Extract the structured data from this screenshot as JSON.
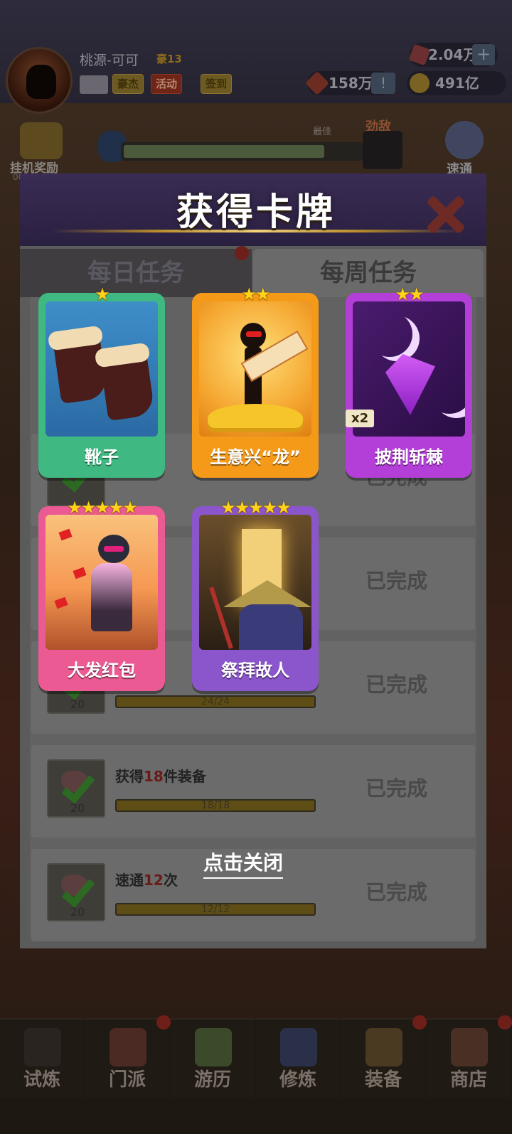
{
  "player": {
    "name": "桃源-可可",
    "rank": "豪13",
    "tags": [
      "豪杰",
      "活动",
      "签到"
    ]
  },
  "resources": {
    "gems": "2.04万",
    "ruby": "158万",
    "gold": "491亿"
  },
  "hud": {
    "hang_reward_label": "挂机奖励",
    "hang_timer": "00:04:43",
    "best_label": "最佳",
    "enemy_label": "劲敌",
    "pass_label": "速通"
  },
  "popup": {
    "title": "获得卡牌",
    "close_hint": "点击关闭"
  },
  "tabs": {
    "daily": "每日任务",
    "weekly": "每周任务"
  },
  "cards": [
    {
      "name": "靴子",
      "stars": "★",
      "badge": ""
    },
    {
      "name": "生意兴“龙”",
      "stars": "★★",
      "badge": ""
    },
    {
      "name": "披荆斩棘",
      "stars": "★★",
      "badge": "x2"
    },
    {
      "name": "大发红包",
      "stars": "★★★★★",
      "badge": ""
    },
    {
      "name": "祭拜故人",
      "stars": "★★★★★",
      "badge": ""
    }
  ],
  "tasks": [
    {
      "status": "已完成",
      "reward": "",
      "desc_pre": "",
      "desc_hl": "",
      "desc_post": "",
      "progress": ""
    },
    {
      "status": "已完成",
      "reward": "",
      "desc_pre": "",
      "desc_hl": "",
      "desc_post": "",
      "progress": ""
    },
    {
      "status": "已完成",
      "reward": "20",
      "desc_pre": "",
      "desc_hl": "",
      "desc_post": "",
      "progress": "24/24"
    },
    {
      "status": "已完成",
      "reward": "20",
      "desc_pre": "获得",
      "desc_hl": "18",
      "desc_post": "件装备",
      "progress": "18/18"
    },
    {
      "status": "已完成",
      "reward": "20",
      "desc_pre": "速通",
      "desc_hl": "12",
      "desc_post": "次",
      "progress": "12/12"
    }
  ],
  "nav": [
    {
      "label": "试炼",
      "badge": false
    },
    {
      "label": "门派",
      "badge": true
    },
    {
      "label": "游历",
      "badge": false
    },
    {
      "label": "修炼",
      "badge": false
    },
    {
      "label": "装备",
      "badge": true
    },
    {
      "label": "商店",
      "badge": true
    }
  ],
  "colors": {
    "card_green": "#3fb882",
    "card_orange": "#f59a18",
    "card_purple": "#b43fd8",
    "card_pink": "#ec5a94",
    "card_violet": "#8b56cc",
    "star": "#ffd21c"
  }
}
